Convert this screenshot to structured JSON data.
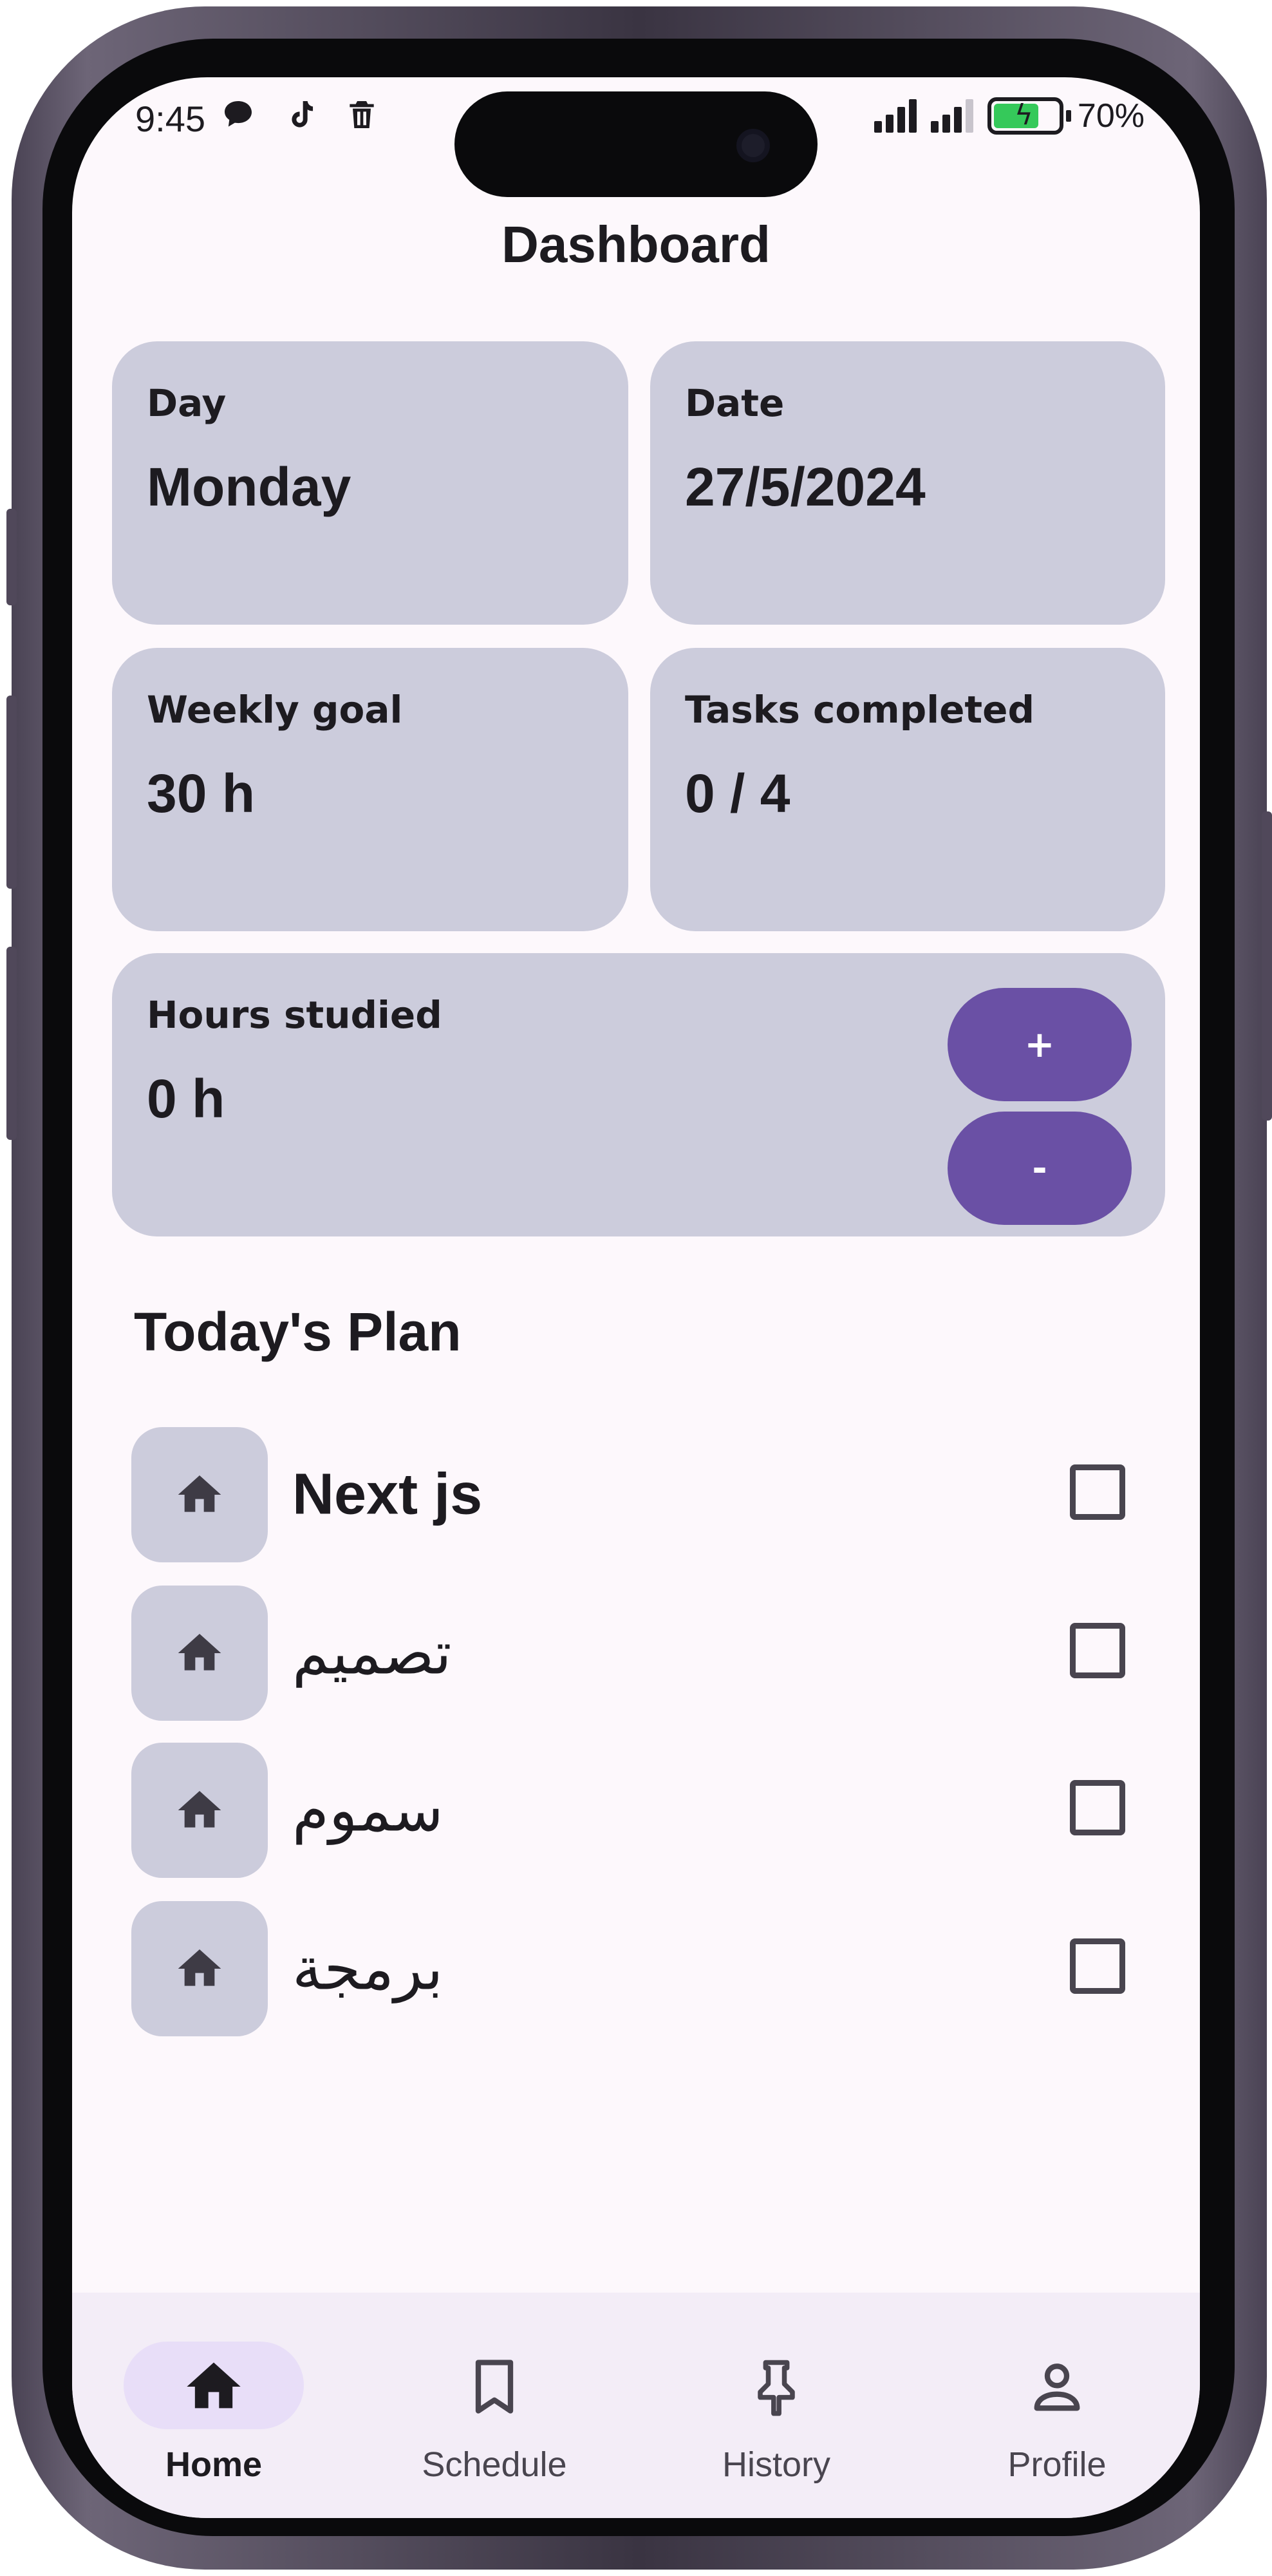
{
  "status_bar": {
    "time": "9:45",
    "battery": "70%",
    "battery_level": 0.7,
    "icons_left": [
      "chat-icon",
      "tiktok-icon",
      "trash-icon"
    ]
  },
  "header": {
    "title": "Dashboard"
  },
  "cards": {
    "day": {
      "label": "Day",
      "value": "Monday"
    },
    "date": {
      "label": "Date",
      "value": "27/5/2024"
    },
    "weekly_goal": {
      "label": "Weekly goal",
      "value": "30 h"
    },
    "tasks_completed": {
      "label": "Tasks completed",
      "value": "0 / 4"
    },
    "hours_studied": {
      "label": "Hours studied",
      "value": "0 h",
      "increment_label": "+",
      "decrement_label": "-"
    }
  },
  "plan": {
    "title": "Today's Plan",
    "items": [
      {
        "title": "Next js",
        "icon": "home-icon",
        "checked": false
      },
      {
        "title": "تصميم",
        "icon": "home-icon",
        "checked": false
      },
      {
        "title": "سموم",
        "icon": "home-icon",
        "checked": false
      },
      {
        "title": "برمجة",
        "icon": "home-icon",
        "checked": false
      }
    ]
  },
  "nav": {
    "items": [
      {
        "label": "Home",
        "icon": "home-icon",
        "active": true
      },
      {
        "label": "Schedule",
        "icon": "bookmark-icon",
        "active": false
      },
      {
        "label": "History",
        "icon": "pin-icon",
        "active": false
      },
      {
        "label": "Profile",
        "icon": "person-icon",
        "active": false
      }
    ]
  },
  "colors": {
    "background": "#fdf8fc",
    "card": "#ccccdc",
    "accent": "#6a50a5",
    "nav_background": "#f3edf7",
    "nav_indicator": "#e8def8",
    "text": "#1d1b20"
  }
}
